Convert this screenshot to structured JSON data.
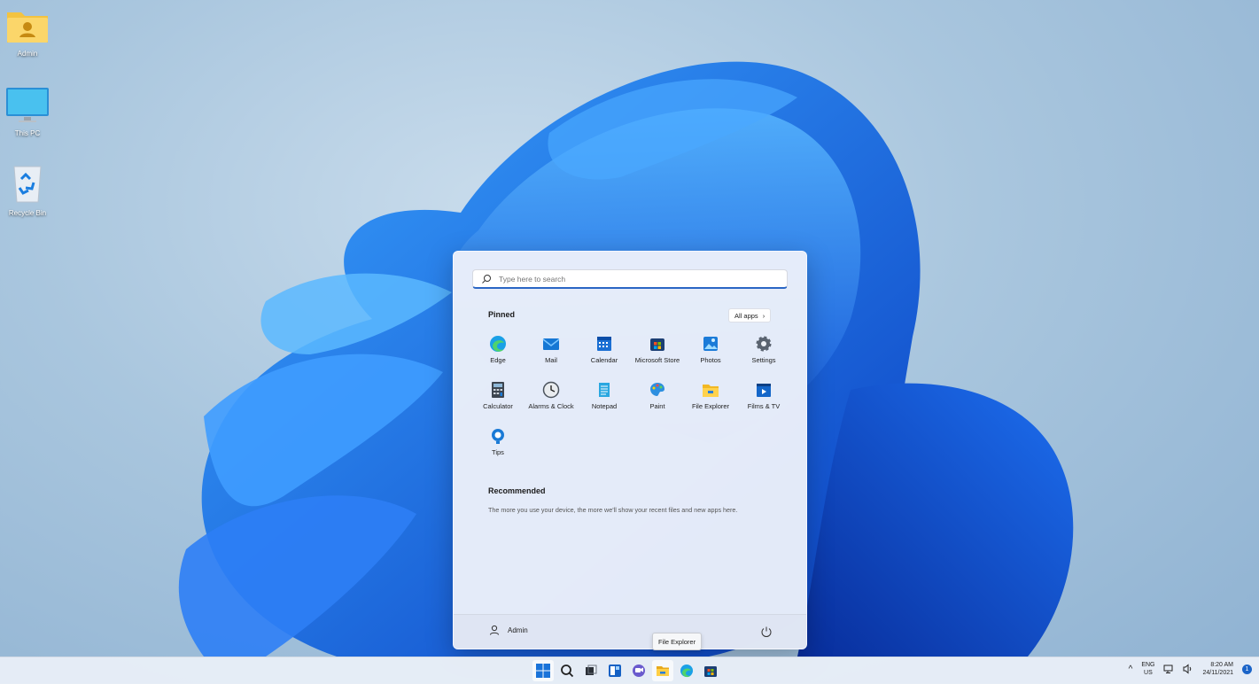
{
  "desktop": {
    "icons": [
      {
        "label": "Admin",
        "icon": "user-folder-icon"
      },
      {
        "label": "This PC",
        "icon": "monitor-icon"
      },
      {
        "label": "Recycle Bin",
        "icon": "recycle-bin-icon"
      }
    ]
  },
  "start_menu": {
    "search_placeholder": "Type here to search",
    "pinned_title": "Pinned",
    "all_apps_label": "All apps",
    "pinned": [
      {
        "name": "Edge",
        "icon": "edge-icon"
      },
      {
        "name": "Mail",
        "icon": "mail-icon"
      },
      {
        "name": "Calendar",
        "icon": "calendar-icon"
      },
      {
        "name": "Microsoft Store",
        "icon": "store-icon"
      },
      {
        "name": "Photos",
        "icon": "photos-icon"
      },
      {
        "name": "Settings",
        "icon": "gear-icon"
      },
      {
        "name": "Calculator",
        "icon": "calculator-icon"
      },
      {
        "name": "Alarms & Clock",
        "icon": "clock-icon"
      },
      {
        "name": "Notepad",
        "icon": "notepad-icon"
      },
      {
        "name": "Paint",
        "icon": "paint-icon"
      },
      {
        "name": "File Explorer",
        "icon": "folder-icon"
      },
      {
        "name": "Films & TV",
        "icon": "films-icon"
      },
      {
        "name": "Tips",
        "icon": "tips-icon"
      }
    ],
    "recommended_title": "Recommended",
    "recommended_message": "The more you use your device, the more we'll show your recent files and new apps here.",
    "user_name": "Admin"
  },
  "tooltip": "File Explorer",
  "taskbar": {
    "apps": [
      "start-icon",
      "search-icon",
      "task-view-icon",
      "widgets-icon",
      "chat-icon",
      "file-explorer-icon",
      "edge-icon",
      "store-icon"
    ],
    "language": "ENG",
    "region": "US",
    "time": "8:20 AM",
    "date": "24/11/2021",
    "notification_count": "1"
  },
  "colors": {
    "accent": "#1b64c8",
    "wallpaper": "#a9c6de"
  }
}
